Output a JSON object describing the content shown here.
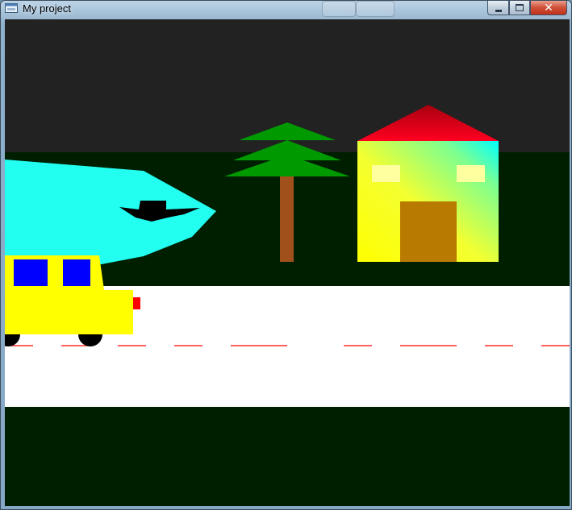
{
  "window": {
    "title": "My project",
    "app_icon": "app-window-icon",
    "controls": {
      "minimize_icon": "minimize-icon",
      "maximize_icon": "maximize-icon",
      "close_label": "✕"
    }
  },
  "scene": {
    "colors": {
      "sky": "#222222",
      "grass": "#001e00",
      "road": "#ffffff",
      "lane_marking": "#ff0000",
      "tree_foliage": "#009900",
      "tree_trunk": "#a0501a",
      "house_roof": "#d00018",
      "house_door": "#b87a00",
      "house_window": "#ffffa0",
      "car_body": "#ffff00",
      "car_window": "#0000ff",
      "car_light": "#ff0000",
      "car_wheel": "#000000",
      "airplane_body": "#22fff0",
      "airplane_detail": "#000000"
    },
    "objects": [
      "airplane",
      "pine-tree",
      "house",
      "car",
      "road"
    ]
  }
}
